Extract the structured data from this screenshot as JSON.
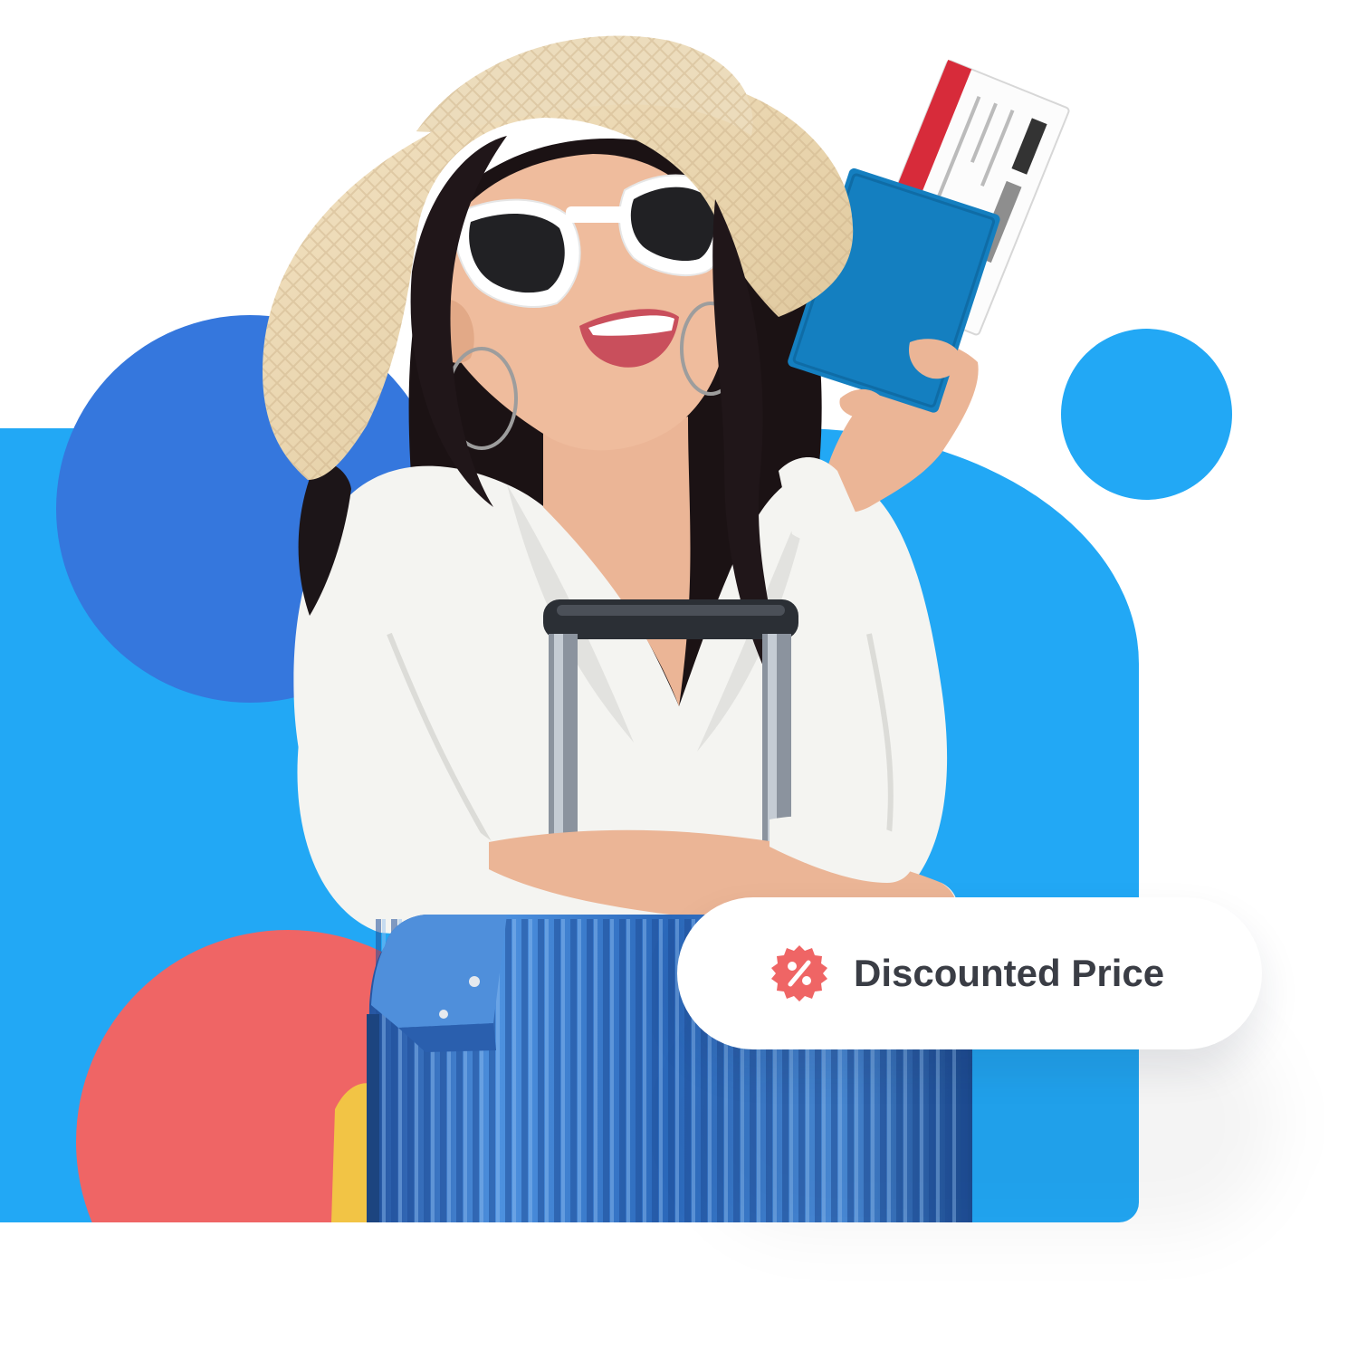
{
  "colors": {
    "panel_blue": "#22a8f5",
    "dark_blue": "#3577dd",
    "coral": "#ef6565",
    "badge_text": "#3a3d45",
    "suitcase_blue": "#2a65b7",
    "passport_blue": "#147fc0"
  },
  "discount_badge": {
    "label": "Discounted Price",
    "icon": "discount-icon"
  },
  "photo": {
    "subject": "traveler-with-suitcase"
  }
}
